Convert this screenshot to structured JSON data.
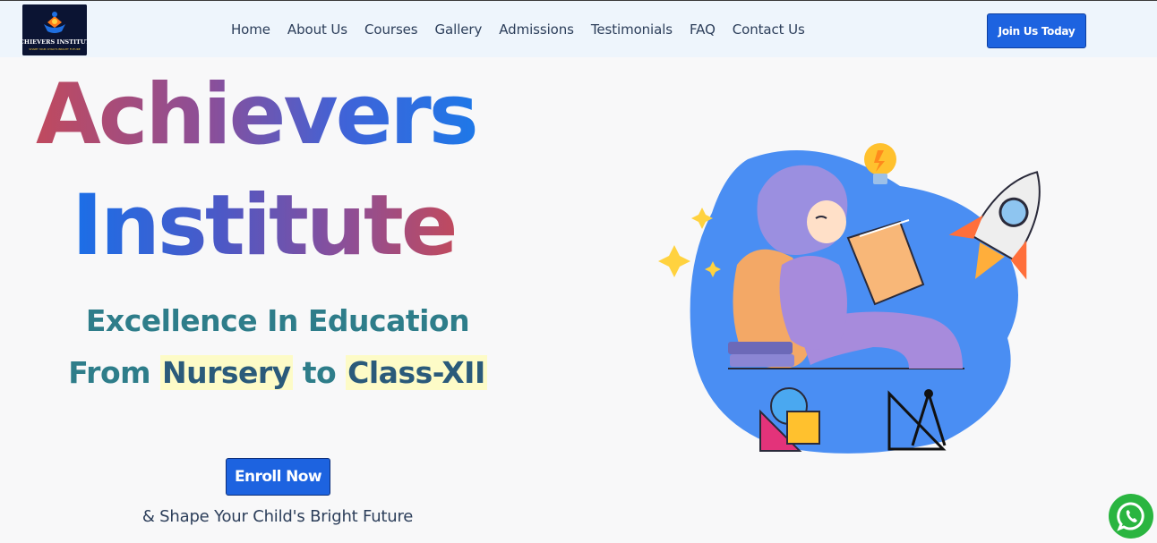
{
  "header": {
    "logo": {
      "text": "ACHIEVERS INSTITUTE",
      "tagline": "SHAPE YOUR CHILD'S BRIGHT FUTURE",
      "icon": "graduation-cap-icon"
    },
    "nav": [
      "Home",
      "About Us",
      "Courses",
      "Gallery",
      "Admissions",
      "Testimonials",
      "FAQ",
      "Contact Us"
    ],
    "cta_label": "Join Us Today"
  },
  "hero": {
    "title_line1": "Achievers",
    "title_line2": "Institute",
    "subtitle_part1": "Excellence In Education",
    "subtitle_part2": "From",
    "highlight1": "Nursery",
    "subtitle_part3": "to",
    "highlight2": "Class-XII",
    "enroll_label": "Enroll Now",
    "tagline": "& Shape Your Child's Bright Future"
  },
  "illustration": {
    "icon": "girl-reading-with-rocket-illustration"
  },
  "floating": {
    "icon": "whatsapp-icon",
    "color": "#2ab540"
  },
  "colors": {
    "accent": "#1d63e0",
    "teal": "#2e7d8a",
    "highlight": "#fdfbc7"
  }
}
